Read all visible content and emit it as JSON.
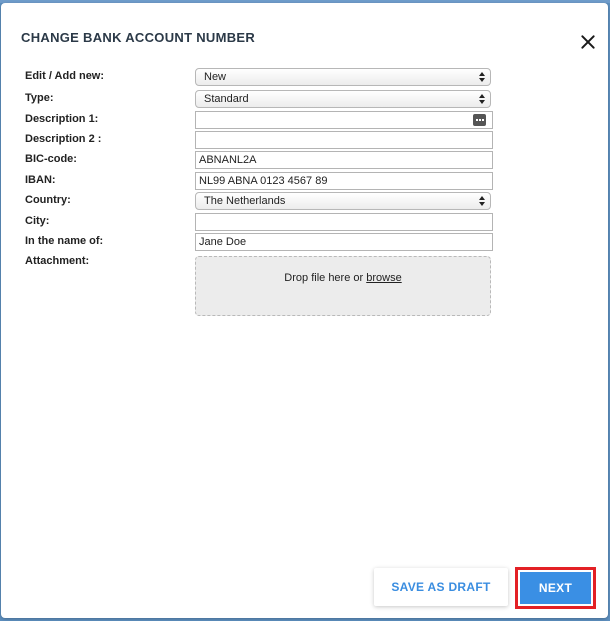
{
  "dialog": {
    "title": "CHANGE BANK ACCOUNT NUMBER",
    "close_icon": "close-icon"
  },
  "form": {
    "edit_add_new": {
      "label": "Edit / Add new:",
      "value": "New"
    },
    "type": {
      "label": "Type:",
      "value": "Standard"
    },
    "description1": {
      "label": "Description 1:",
      "value": "",
      "action_icon": "more-dots-icon"
    },
    "description2": {
      "label": "Description 2 :",
      "value": ""
    },
    "bic_code": {
      "label": "BIC-code:",
      "value": "ABNANL2A"
    },
    "iban": {
      "label": "IBAN:",
      "value": "NL99 ABNA 0123 4567 89"
    },
    "country": {
      "label": "Country:",
      "value": "The Netherlands"
    },
    "city": {
      "label": "City:",
      "value": ""
    },
    "in_the_name_of": {
      "label": "In the name of:",
      "value": "Jane Doe"
    },
    "attachment": {
      "label": "Attachment:",
      "drop_text": "Drop file here or ",
      "browse_link": "browse"
    }
  },
  "footer": {
    "save_draft_label": "SAVE AS DRAFT",
    "next_label": "NEXT"
  },
  "colors": {
    "accent": "#3a8fe4",
    "highlight_border": "#e32025",
    "backdrop": "#5d8fbf"
  }
}
